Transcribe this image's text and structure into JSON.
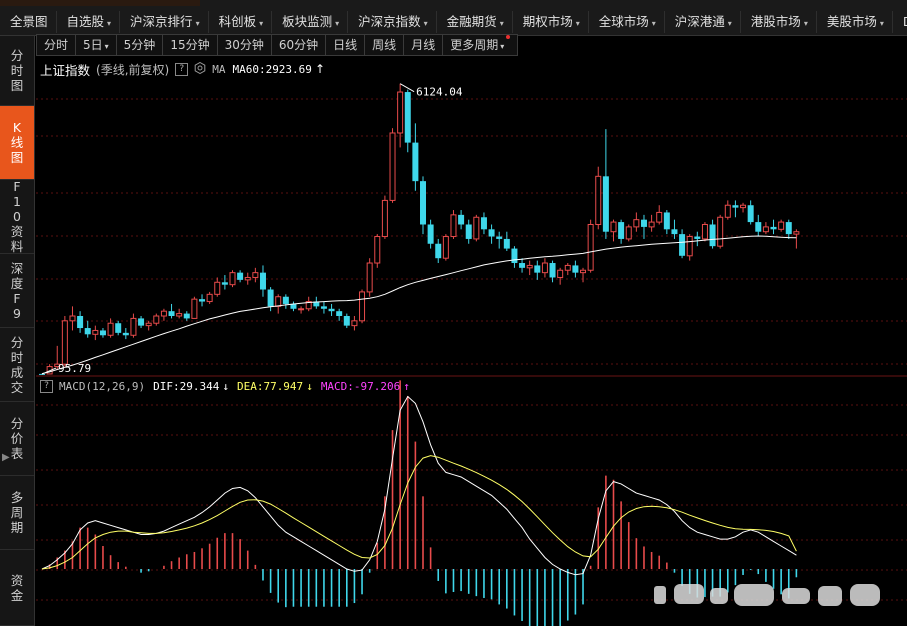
{
  "menu": {
    "items": [
      {
        "label": "全景图",
        "dropdown": false
      },
      {
        "label": "自选股",
        "dropdown": true
      },
      {
        "label": "沪深京排行",
        "dropdown": true
      },
      {
        "label": "科创板",
        "dropdown": true
      },
      {
        "label": "板块监测",
        "dropdown": true
      },
      {
        "label": "沪深京指数",
        "dropdown": true
      },
      {
        "label": "金融期货",
        "dropdown": true
      },
      {
        "label": "期权市场",
        "dropdown": true
      },
      {
        "label": "全球市场",
        "dropdown": true
      },
      {
        "label": "沪深港通",
        "dropdown": true
      },
      {
        "label": "港股市场",
        "dropdown": true
      },
      {
        "label": "美股市场",
        "dropdown": true
      },
      {
        "label": "DDE",
        "dropdown": false
      }
    ]
  },
  "sidebar": {
    "items": [
      {
        "label": "分时图",
        "active": false
      },
      {
        "label": "K线图",
        "active": true
      },
      {
        "label": "F10资料",
        "active": false
      },
      {
        "label": "深度F9",
        "active": false
      },
      {
        "label": "分时成交",
        "active": false
      },
      {
        "label": "分价表",
        "active": false
      },
      {
        "label": "多周期",
        "active": false
      },
      {
        "label": "资金",
        "active": false
      }
    ]
  },
  "periods": {
    "items": [
      "分时",
      "5日",
      "5分钟",
      "15分钟",
      "30分钟",
      "60分钟",
      "日线",
      "周线",
      "月线",
      "更多周期"
    ],
    "caret_label": "▾"
  },
  "info": {
    "index_name": "上证指数",
    "kline_mode": "(季线,前复权)",
    "help": "?",
    "ma_label": "MA",
    "ma60_text": "MA60:2923.69",
    "ma60_arrow": "↑"
  },
  "macd": {
    "help": "?",
    "params": "MACD(12,26,9)",
    "dif": "DIF:29.344",
    "dif_arrow": "↓",
    "dea": "DEA:77.947",
    "dea_arrow": "↓",
    "macd": "MACD:-97.206",
    "macd_arrow": "↑"
  },
  "colors": {
    "up": "#e84b4b",
    "down": "#3fd7ea",
    "ma": "#ffffff",
    "dea": "#ffff66",
    "dif": "#ffffff",
    "macd_text": "#ff44ff",
    "accent": "#e8561c",
    "grid": "#8a1a1a"
  },
  "chart_data": {
    "type": "candlestick",
    "period": "quarterly",
    "price_range": [
      75,
      6200
    ],
    "annotations": {
      "high": "6124.04",
      "low": "95.79"
    },
    "candles": [
      [
        98,
        99,
        95,
        97
      ],
      [
        97,
        300,
        96,
        250
      ],
      [
        250,
        680,
        200,
        300
      ],
      [
        300,
        1300,
        250,
        1200
      ],
      [
        1200,
        1500,
        1000,
        1300
      ],
      [
        1300,
        1400,
        950,
        1050
      ],
      [
        1050,
        1200,
        850,
        920
      ],
      [
        920,
        1100,
        800,
        1000
      ],
      [
        1000,
        1050,
        850,
        900
      ],
      [
        900,
        1250,
        850,
        1150
      ],
      [
        1150,
        1200,
        900,
        950
      ],
      [
        950,
        1050,
        820,
        900
      ],
      [
        900,
        1350,
        850,
        1250
      ],
      [
        1250,
        1300,
        1050,
        1100
      ],
      [
        1100,
        1200,
        1000,
        1150
      ],
      [
        1150,
        1350,
        1100,
        1300
      ],
      [
        1300,
        1450,
        1200,
        1400
      ],
      [
        1400,
        1550,
        1250,
        1300
      ],
      [
        1300,
        1450,
        1250,
        1350
      ],
      [
        1350,
        1400,
        1200,
        1250
      ],
      [
        1250,
        1700,
        1250,
        1650
      ],
      [
        1650,
        1750,
        1500,
        1600
      ],
      [
        1600,
        1800,
        1550,
        1750
      ],
      [
        1750,
        2100,
        1700,
        2000
      ],
      [
        2000,
        2150,
        1850,
        1950
      ],
      [
        1950,
        2250,
        1900,
        2200
      ],
      [
        2200,
        2250,
        2000,
        2050
      ],
      [
        2050,
        2200,
        1950,
        2100
      ],
      [
        2100,
        2300,
        2000,
        2200
      ],
      [
        2200,
        2350,
        1700,
        1850
      ],
      [
        1850,
        1900,
        1400,
        1500
      ],
      [
        1500,
        1750,
        1350,
        1700
      ],
      [
        1700,
        1750,
        1450,
        1550
      ],
      [
        1550,
        1600,
        1400,
        1450
      ],
      [
        1450,
        1500,
        1350,
        1450
      ],
      [
        1450,
        1700,
        1400,
        1600
      ],
      [
        1600,
        1700,
        1450,
        1500
      ],
      [
        1500,
        1600,
        1350,
        1450
      ],
      [
        1450,
        1550,
        1300,
        1400
      ],
      [
        1400,
        1450,
        1200,
        1300
      ],
      [
        1300,
        1350,
        1050,
        1100
      ],
      [
        1100,
        1300,
        1000,
        1200
      ],
      [
        1200,
        1850,
        1150,
        1800
      ],
      [
        1800,
        2500,
        1700,
        2400
      ],
      [
        2400,
        3000,
        2300,
        2950
      ],
      [
        2950,
        3800,
        2900,
        3700
      ],
      [
        3700,
        5200,
        3650,
        5100
      ],
      [
        5100,
        6124,
        4800,
        5950
      ],
      [
        5950,
        6000,
        4700,
        4900
      ],
      [
        4900,
        5300,
        3900,
        4100
      ],
      [
        4100,
        4200,
        3000,
        3200
      ],
      [
        3200,
        3300,
        2700,
        2800
      ],
      [
        2800,
        2900,
        2400,
        2500
      ],
      [
        2500,
        3000,
        2450,
        2950
      ],
      [
        2950,
        3500,
        2900,
        3400
      ],
      [
        3400,
        3500,
        3100,
        3200
      ],
      [
        3200,
        3300,
        2800,
        2900
      ],
      [
        2900,
        3400,
        2850,
        3350
      ],
      [
        3350,
        3450,
        3000,
        3100
      ],
      [
        3100,
        3200,
        2800,
        2950
      ],
      [
        2950,
        3050,
        2700,
        2900
      ],
      [
        2900,
        3050,
        2650,
        2700
      ],
      [
        2700,
        2750,
        2300,
        2400
      ],
      [
        2400,
        2500,
        2200,
        2300
      ],
      [
        2300,
        2450,
        2150,
        2350
      ],
      [
        2350,
        2450,
        2050,
        2200
      ],
      [
        2200,
        2500,
        2100,
        2400
      ],
      [
        2400,
        2450,
        2000,
        2100
      ],
      [
        2100,
        2300,
        1950,
        2250
      ],
      [
        2250,
        2400,
        2150,
        2350
      ],
      [
        2350,
        2450,
        2100,
        2200
      ],
      [
        2200,
        2300,
        2000,
        2250
      ],
      [
        2250,
        3300,
        2200,
        3200
      ],
      [
        3200,
        4400,
        3100,
        4200
      ],
      [
        4200,
        5180,
        2900,
        3050
      ],
      [
        3050,
        3300,
        2850,
        3250
      ],
      [
        3250,
        3300,
        2800,
        2900
      ],
      [
        2900,
        3200,
        2850,
        3150
      ],
      [
        3150,
        3450,
        3050,
        3300
      ],
      [
        3300,
        3400,
        2900,
        3150
      ],
      [
        3150,
        3400,
        3050,
        3250
      ],
      [
        3250,
        3600,
        3200,
        3450
      ],
      [
        3450,
        3500,
        3000,
        3100
      ],
      [
        3100,
        3300,
        2900,
        3000
      ],
      [
        3000,
        3100,
        2500,
        2550
      ],
      [
        2550,
        3000,
        2450,
        2950
      ],
      [
        2950,
        3050,
        2750,
        2900
      ],
      [
        2900,
        3250,
        2850,
        3200
      ],
      [
        3200,
        3300,
        2700,
        2750
      ],
      [
        2750,
        3400,
        2700,
        3350
      ],
      [
        3350,
        3700,
        3300,
        3600
      ],
      [
        3600,
        3700,
        3350,
        3550
      ],
      [
        3550,
        3650,
        3450,
        3600
      ],
      [
        3600,
        3700,
        3200,
        3250
      ],
      [
        3250,
        3400,
        2950,
        3050
      ],
      [
        3050,
        3250,
        3000,
        3150
      ],
      [
        3150,
        3300,
        3000,
        3100
      ],
      [
        3100,
        3300,
        3050,
        3250
      ],
      [
        3250,
        3300,
        2900,
        3000
      ],
      [
        3000,
        3100,
        2700,
        3050
      ]
    ],
    "ma60": [
      105,
      140,
      190,
      235,
      280,
      330,
      385,
      440,
      495,
      550,
      605,
      660,
      715,
      770,
      825,
      880,
      935,
      985,
      1035,
      1090,
      1140,
      1190,
      1240,
      1280,
      1320,
      1360,
      1395,
      1420,
      1445,
      1470,
      1490,
      1510,
      1530,
      1550,
      1565,
      1580,
      1590,
      1600,
      1610,
      1615,
      1620,
      1630,
      1650,
      1670,
      1700,
      1750,
      1820,
      1890,
      1950,
      2000,
      2040,
      2080,
      2120,
      2160,
      2200,
      2240,
      2280,
      2320,
      2360,
      2390,
      2420,
      2445,
      2465,
      2480,
      2500,
      2515,
      2530,
      2540,
      2555,
      2570,
      2585,
      2600,
      2630,
      2660,
      2690,
      2710,
      2730,
      2745,
      2760,
      2775,
      2790,
      2800,
      2810,
      2820,
      2830,
      2845,
      2860,
      2875,
      2890,
      2900,
      2915,
      2930,
      2945,
      2955,
      2960,
      2955,
      2945,
      2935,
      2928,
      2923.69
    ],
    "dif": [
      0,
      15,
      40,
      70,
      110,
      170,
      200,
      210,
      200,
      190,
      180,
      170,
      160,
      150,
      150,
      155,
      165,
      180,
      195,
      210,
      225,
      245,
      270,
      300,
      330,
      350,
      355,
      340,
      310,
      270,
      230,
      190,
      160,
      140,
      120,
      100,
      80,
      60,
      40,
      20,
      0,
      -10,
      -5,
      40,
      120,
      260,
      480,
      690,
      750,
      720,
      640,
      540,
      460,
      420,
      410,
      400,
      380,
      360,
      340,
      320,
      290,
      260,
      220,
      180,
      130,
      90,
      50,
      20,
      0,
      -15,
      -25,
      -20,
      60,
      220,
      340,
      380,
      370,
      350,
      330,
      320,
      310,
      300,
      280,
      250,
      210,
      180,
      160,
      150,
      140,
      130,
      130,
      140,
      160,
      170,
      160,
      140,
      120,
      100,
      80,
      60
    ],
    "dea": [
      0,
      5,
      15,
      30,
      50,
      80,
      110,
      135,
      150,
      160,
      165,
      165,
      160,
      158,
      155,
      155,
      158,
      163,
      170,
      178,
      188,
      200,
      215,
      232,
      252,
      272,
      290,
      300,
      301,
      295,
      282,
      263,
      243,
      222,
      202,
      182,
      162,
      142,
      122,
      102,
      82,
      64,
      50,
      48,
      63,
      102,
      178,
      280,
      374,
      443,
      482,
      493,
      486,
      473,
      460,
      448,
      434,
      419,
      403,
      386,
      367,
      346,
      321,
      293,
      261,
      227,
      192,
      158,
      126,
      97,
      74,
      57,
      53,
      86,
      137,
      186,
      223,
      248,
      263,
      271,
      273,
      271,
      266,
      258,
      247,
      234,
      222,
      211,
      200,
      190,
      181,
      175,
      173,
      172,
      171,
      168,
      163,
      155,
      144,
      78
    ]
  }
}
